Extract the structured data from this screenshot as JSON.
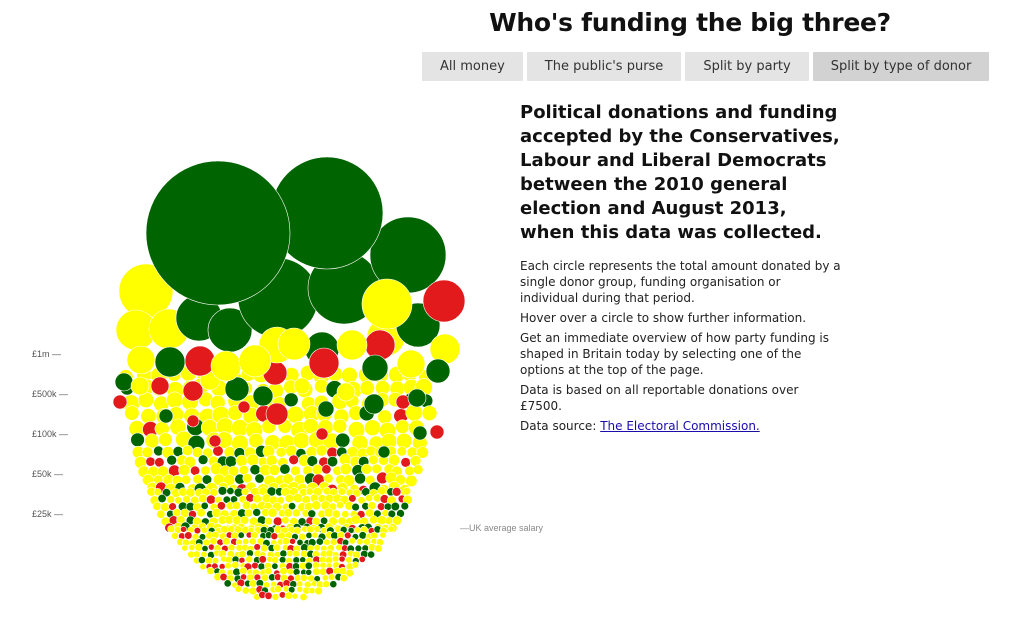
{
  "title": "Who's funding the big three?",
  "tabs": [
    {
      "label": "All money",
      "active": false
    },
    {
      "label": "The public's purse",
      "active": false
    },
    {
      "label": "Split by party",
      "active": false
    },
    {
      "label": "Split by type of donor",
      "active": true
    }
  ],
  "intro": "Political donations and funding accepted by the Conservatives, Labour and Liberal Democrats between the 2010 general election and August 2013, when this data was collected.",
  "description": {
    "p1": "Each circle represents the total amount donated by a single donor group, funding organisation or individual during that period.",
    "p2": "Hover over a circle to show further information.",
    "p3": "Get an immediate overview of how party funding is shaped in Britain today by selecting one of the options at the top of the page.",
    "p4": "Data is based on all reportable donations over £7500.",
    "source_prefix": "Data source: ",
    "source_link": "The Electoral Commission."
  },
  "chart_data": {
    "type": "scatter",
    "title": "",
    "y_scale_labels": [
      "£1m —",
      "£500k —",
      "£100k —",
      "£50k —",
      "£25k —"
    ],
    "annotation": "—UK average salary",
    "colors": {
      "green": "#006400",
      "yellow": "#ffff00",
      "red": "#e31a1c"
    },
    "largest_donations": [
      {
        "color": "green",
        "relative_size": 1.0
      },
      {
        "color": "green",
        "relative_size": 0.8
      },
      {
        "color": "green",
        "relative_size": 0.53
      },
      {
        "color": "green",
        "relative_size": 0.52
      },
      {
        "color": "green",
        "relative_size": 0.5
      },
      {
        "color": "red",
        "relative_size": 0.15
      },
      {
        "color": "yellow",
        "relative_size": 0.18
      }
    ]
  }
}
